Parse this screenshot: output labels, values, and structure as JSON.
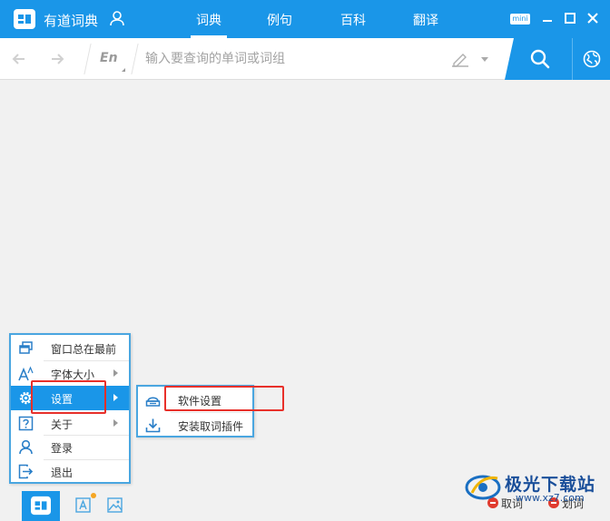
{
  "app": {
    "title": "有道词典"
  },
  "tabs": [
    {
      "label": "词典",
      "active": true
    },
    {
      "label": "例句",
      "active": false
    },
    {
      "label": "百科",
      "active": false
    },
    {
      "label": "翻译",
      "active": false
    }
  ],
  "window_controls": {
    "mini_label": "mini"
  },
  "search": {
    "lang_label": "En",
    "placeholder": "输入要查询的单词或词组",
    "value": ""
  },
  "menu": {
    "items": [
      {
        "label": "窗口总在最前",
        "icon": "window-stack-icon",
        "has_submenu": false
      },
      {
        "label": "字体大小",
        "icon": "font-size-icon",
        "has_submenu": true
      },
      {
        "label": "设置",
        "icon": "gear-icon",
        "has_submenu": true,
        "highlighted": true
      },
      {
        "label": "关于",
        "icon": "help-icon",
        "has_submenu": true
      },
      {
        "label": "登录",
        "icon": "user-icon",
        "has_submenu": false
      },
      {
        "label": "退出",
        "icon": "exit-icon",
        "has_submenu": false
      }
    ]
  },
  "submenu": {
    "items": [
      {
        "label": "软件设置",
        "icon": "settings-panel-icon"
      },
      {
        "label": "安装取词插件",
        "icon": "download-icon"
      }
    ]
  },
  "bottom": {
    "toggles": [
      {
        "label": "取词"
      },
      {
        "label": "划词"
      }
    ]
  },
  "watermark": {
    "text": "极光下载站",
    "url": "www.xz7.com"
  },
  "colors": {
    "accent": "#1a96e8",
    "highlight_box": "#e8302a",
    "toggle_off": "#e03b2f"
  }
}
